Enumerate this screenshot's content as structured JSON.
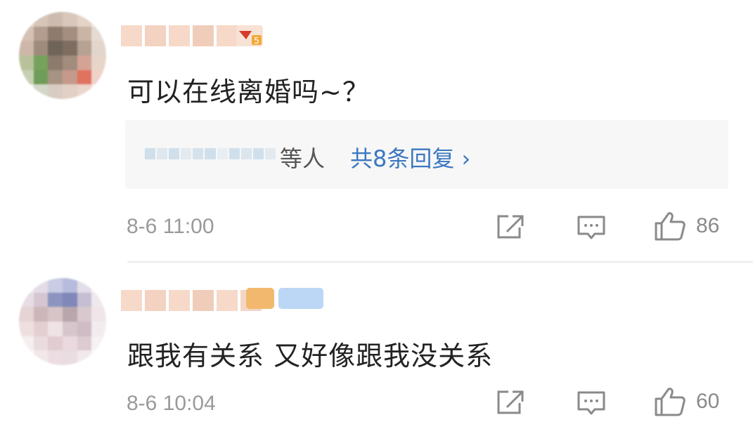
{
  "comments": [
    {
      "text": "可以在线离婚吗~？",
      "reply_preview": {
        "suffix": "等人",
        "link": "共8条回复 ›"
      },
      "time": "8-6 11:00",
      "likes": "86",
      "level_badge": "5"
    },
    {
      "text": "跟我有关系 又好像跟我没关系",
      "time": "8-6 10:04",
      "likes": "60"
    }
  ],
  "icons": [
    "share-icon",
    "comment-icon",
    "like-icon"
  ],
  "colors": {
    "link": "#3b78c1",
    "meta": "#9a9a9a",
    "reply_bg": "#f7f7f7"
  }
}
